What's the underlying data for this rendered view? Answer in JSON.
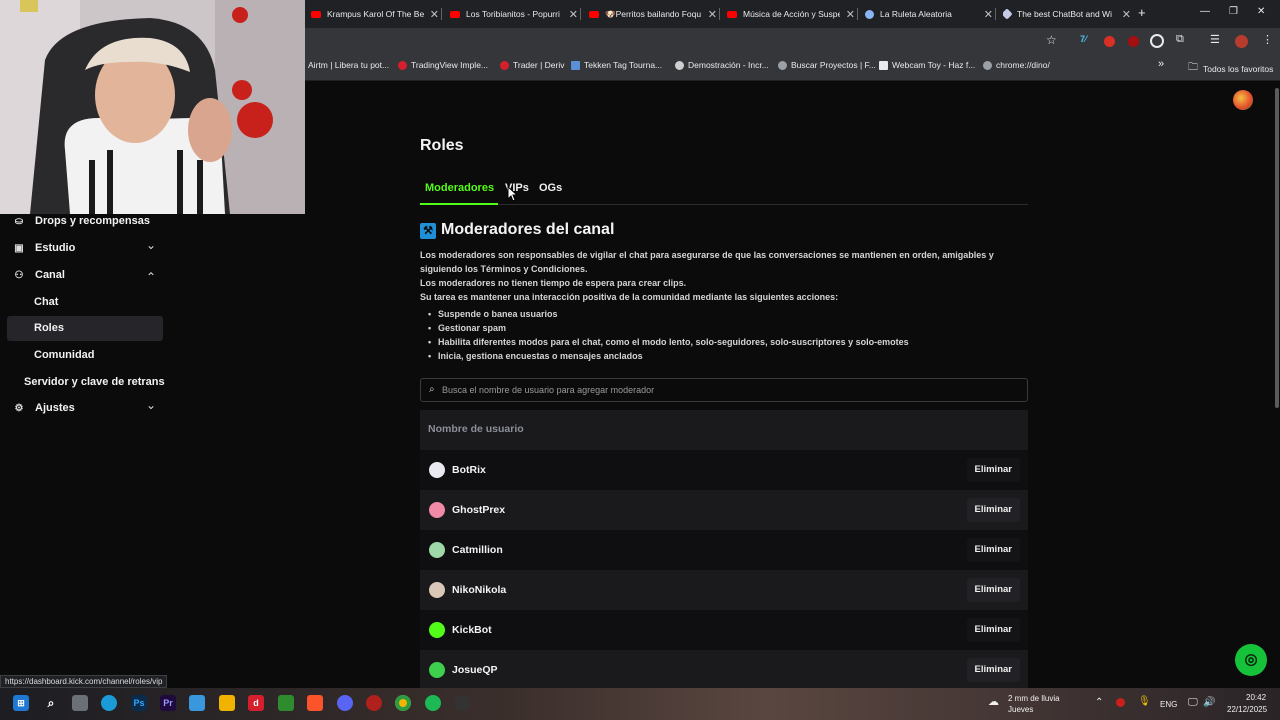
{
  "browser": {
    "tabs": [
      {
        "title": "Krampus Karol Of The Bel",
        "color": "#ff0000"
      },
      {
        "title": "Los Toribianitos - Popurri",
        "color": "#ff0000"
      },
      {
        "title": "🐶Perritos bailando Foqu",
        "color": "#ff0000"
      },
      {
        "title": "Música de Acción y Suspe",
        "color": "#ff0000"
      },
      {
        "title": "La Ruleta Aleatoria",
        "color": "#8ab4f8"
      },
      {
        "title": "The best ChatBot and Wi",
        "color": "#c5cae9"
      }
    ],
    "new_tab": "+",
    "bookmarks": [
      "Airtm | Libera tu pot...",
      "TradingView Imple...",
      "Trader | Deriv",
      "Tekken Tag Tourna...",
      "Demostración - Incr...",
      "Buscar Proyectos | F...",
      "Webcam Toy - Haz f...",
      "chrome://dino/"
    ],
    "all_bookmarks": "Todos los favoritos",
    "more_bookmarks": "»",
    "status_url": "https://dashboard.kick.com/channel/roles/vip"
  },
  "sidebar": {
    "items": [
      {
        "label": "Drops y recompensas",
        "icon": "⛀"
      },
      {
        "label": "Estudio",
        "icon": "▣",
        "chevron": "⌄"
      },
      {
        "label": "Canal",
        "icon": "⚇",
        "chevron": "⌃"
      },
      {
        "label": "Chat"
      },
      {
        "label": "Roles"
      },
      {
        "label": "Comunidad"
      },
      {
        "label": "Servidor y clave de retrans"
      },
      {
        "label": "Ajustes",
        "icon": "⚙",
        "chevron": "⌄"
      }
    ]
  },
  "main": {
    "title": "Roles",
    "tabs": [
      "Moderadores",
      "VIPs",
      "OGs"
    ],
    "active_color": "#53fc18",
    "section_title": "Moderadores del canal",
    "section_icon": "⚒",
    "description": [
      "Los moderadores son responsables de vigilar el chat para asegurarse de que las conversaciones se mantienen en orden, amigables y",
      "siguiendo los Términos y Condiciones.",
      "Los moderadores no tienen tiempo de espera para crear clips.",
      "Su tarea es mantener una interacción positiva de la comunidad mediante las siguientes acciones:"
    ],
    "bullets": [
      "Suspende o banea usuarios",
      "Gestionar spam",
      "Habilita diferentes modos para el chat, como el modo lento, solo-seguidores, solo-suscriptores y solo-emotes",
      "Inicia, gestiona encuestas o mensajes anclados"
    ],
    "search_placeholder": "Busca el nombre de usuario para agregar moderador",
    "table_header": "Nombre de usuario",
    "remove_label": "Eliminar",
    "moderators": [
      {
        "name": "BotRix",
        "avatar_color": "#e9e9ef"
      },
      {
        "name": "GhostPrex",
        "avatar_color": "#f08aa6"
      },
      {
        "name": "Catmillion",
        "avatar_color": "#9fd7a8"
      },
      {
        "name": "NikoNikola",
        "avatar_color": "#d9c8b8"
      },
      {
        "name": "KickBot",
        "avatar_color": "#53fc18"
      },
      {
        "name": "JosueQP",
        "avatar_color": "#3ecf4d"
      }
    ]
  },
  "taskbar": {
    "weather": "2 mm de lluvia",
    "weather_day": "Jueves",
    "lang": "ENG",
    "time": "20:42",
    "date": "22/12/2025",
    "tray_arrow": "⌃"
  }
}
